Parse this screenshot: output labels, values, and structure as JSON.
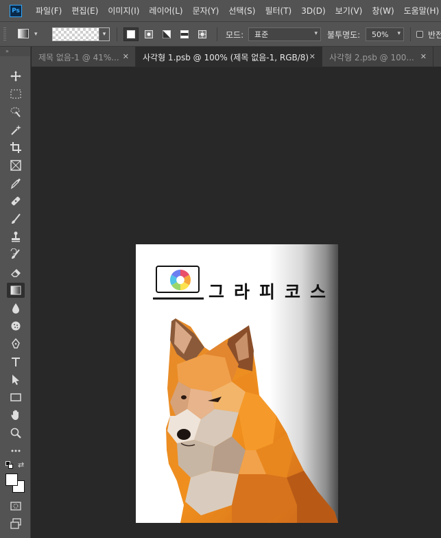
{
  "app": {
    "logo_text": "Ps"
  },
  "menu": [
    "파일(F)",
    "편집(E)",
    "이미지(I)",
    "레이어(L)",
    "문자(Y)",
    "선택(S)",
    "필터(T)",
    "3D(D)",
    "보기(V)",
    "창(W)",
    "도움말(H)"
  ],
  "options": {
    "mode_label": "모드:",
    "mode_value": "표준",
    "opacity_label": "불투명도:",
    "opacity_value": "50%",
    "reverse_label": "반전"
  },
  "tabs": [
    {
      "label": "제목 없음-1 @ 41%..."
    },
    {
      "label": "사각형 1.psb @ 100% (제목 없음-1, RGB/8)"
    },
    {
      "label": "사각형 2.psb @ 100..."
    }
  ],
  "document": {
    "logo_text": "그라피코스"
  },
  "colors": {
    "foreground": "#ffffff",
    "background": "#ffffff",
    "ui_panel": "#535353",
    "canvas_bg": "#282828",
    "accent": "#31a8ff"
  },
  "tools": [
    "move-icon",
    "marquee-icon",
    "quick-select-icon",
    "magic-wand-icon",
    "crop-icon",
    "frame-icon",
    "eyedropper-icon",
    "healing-brush-icon",
    "brush-icon",
    "clone-stamp-icon",
    "history-brush-icon",
    "eraser-icon",
    "gradient-icon",
    "blur-icon",
    "sponge-icon",
    "pen-icon",
    "type-icon",
    "path-select-icon",
    "rectangle-icon",
    "hand-icon",
    "zoom-icon",
    "more-tools-icon"
  ]
}
